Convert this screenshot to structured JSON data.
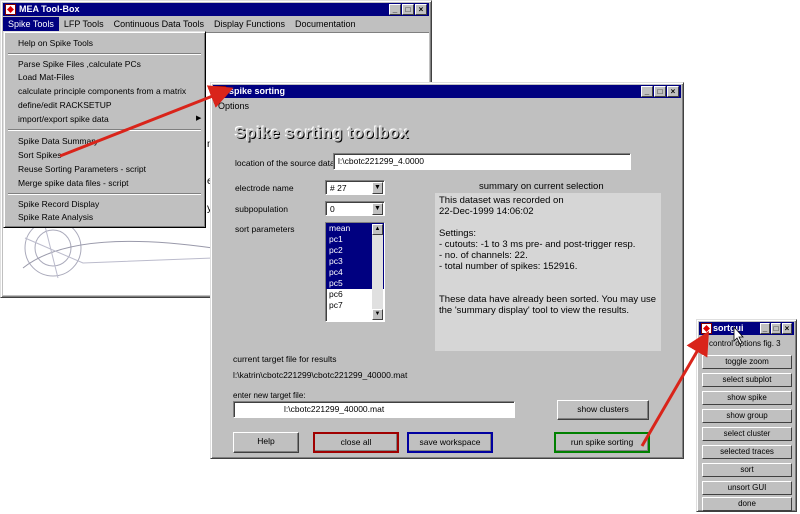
{
  "main_window": {
    "title": "MEA Tool-Box",
    "menu": [
      "Spike Tools",
      "LFP Tools",
      "Continuous Data Tools",
      "Display Functions",
      "Documentation"
    ],
    "body_text_fragments": [
      "m",
      "er",
      "ys"
    ]
  },
  "spike_tools_menu": {
    "items": [
      "Help on Spike Tools",
      "Parse Spike Files ,calculate PCs",
      "Load Mat-Files",
      "calculate principle components from a matrix",
      "define/edit RACKSETUP",
      "import/export spike data",
      "Spike Data Summary",
      "Sort Spikes",
      "Reuse Sorting Parameters - script",
      "Merge spike data files - script",
      "Spike Record Display",
      "Spike Rate Analysis"
    ],
    "submenu_arrow": "▶"
  },
  "spike_sorting_window": {
    "title": "spike sorting",
    "menu": [
      "Options"
    ],
    "heading": "Spike sorting toolbox",
    "source_label": "location of the source data file",
    "source_value": "l:\\cbotc221299_4.0000",
    "electrode_label": "electrode name",
    "electrode_value": "# 27",
    "subpop_label": "subpopulation",
    "subpop_value": "0",
    "sort_params_label": "sort parameters",
    "sort_params": [
      "mean",
      "pc1",
      "pc2",
      "pc3",
      "pc4",
      "pc5",
      "pc6",
      "pc7"
    ],
    "summary_title": "summary on current selection",
    "summary_text": "This dataset was recorded on\n22-Dec-1999 14:06:02\n\nSettings:\n- cutouts: -1 to 3 ms pre- and post-trigger resp.\n- no. of channels: 22.\n- total number of spikes: 152916.\n\n\nThese data have already been sorted. You may use the 'summary display' tool to view the results.",
    "target_label": "current target file for results",
    "target_value": "l:\\katrin\\cbotc221299\\cbotc221299_40000.mat",
    "new_target_label": "enter new target file:",
    "new_target_value": "l:\\cbotc221299_40000.mat",
    "btn_show_clusters": "show clusters",
    "btn_help": "Help",
    "btn_close_all": "close all",
    "btn_save_workspace": "save workspace",
    "btn_run": "run spike sorting"
  },
  "sortgui_window": {
    "title": "sortgui",
    "label": "control options fig. 3",
    "buttons": [
      "toggle zoom",
      "select subplot",
      "show spike",
      "show group",
      "select cluster",
      "selected traces",
      "sort",
      "unsort GUI",
      "done"
    ]
  },
  "colors": {
    "titlebar": "#000080",
    "arrow": "#d9241a",
    "close_border": "#a00000",
    "save_border": "#0000a0",
    "run_border": "#008000"
  }
}
